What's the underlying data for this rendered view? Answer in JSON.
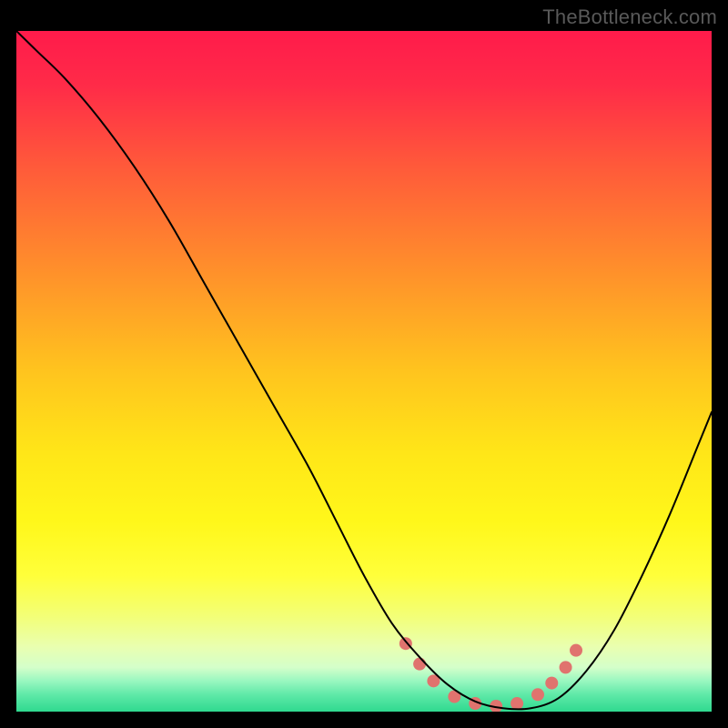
{
  "attribution": "TheBottleneck.com",
  "chart_data": {
    "type": "line",
    "title": "",
    "xlabel": "",
    "ylabel": "",
    "xlim": [
      0,
      100
    ],
    "ylim": [
      0,
      100
    ],
    "background_gradient": {
      "stops": [
        {
          "offset": 0.0,
          "color": "#ff1b4b"
        },
        {
          "offset": 0.08,
          "color": "#ff2b48"
        },
        {
          "offset": 0.2,
          "color": "#ff5a3a"
        },
        {
          "offset": 0.35,
          "color": "#ff8f2b"
        },
        {
          "offset": 0.5,
          "color": "#ffc41e"
        },
        {
          "offset": 0.62,
          "color": "#ffe618"
        },
        {
          "offset": 0.72,
          "color": "#fff71a"
        },
        {
          "offset": 0.8,
          "color": "#ffff3a"
        },
        {
          "offset": 0.86,
          "color": "#f3ff77"
        },
        {
          "offset": 0.905,
          "color": "#e9ffb0"
        },
        {
          "offset": 0.935,
          "color": "#d4ffca"
        },
        {
          "offset": 0.955,
          "color": "#99f7c0"
        },
        {
          "offset": 0.975,
          "color": "#5fe9a8"
        },
        {
          "offset": 1.0,
          "color": "#2fd98f"
        }
      ]
    },
    "series": [
      {
        "name": "bottleneck-curve",
        "color": "#000000",
        "width": 2.0,
        "x": [
          0,
          3,
          7,
          12,
          17,
          22,
          27,
          32,
          37,
          42,
          46,
          50,
          54,
          58,
          62,
          66,
          70,
          74,
          78,
          82,
          86,
          90,
          94,
          98,
          100
        ],
        "values": [
          100,
          97,
          93,
          87,
          80,
          72,
          63,
          54,
          45,
          36,
          28,
          20,
          13,
          8,
          4,
          1.5,
          0.5,
          0.5,
          2,
          6,
          12,
          20,
          29,
          39,
          44
        ]
      }
    ],
    "markers": {
      "name": "optimal-band",
      "color": "#e0736e",
      "radius": 7,
      "points": [
        {
          "x": 56,
          "y": 10
        },
        {
          "x": 58,
          "y": 7
        },
        {
          "x": 60,
          "y": 4.5
        },
        {
          "x": 63,
          "y": 2.2
        },
        {
          "x": 66,
          "y": 1.2
        },
        {
          "x": 69,
          "y": 0.8
        },
        {
          "x": 72,
          "y": 1.2
        },
        {
          "x": 75,
          "y": 2.5
        },
        {
          "x": 77,
          "y": 4.2
        },
        {
          "x": 79,
          "y": 6.5
        },
        {
          "x": 80.5,
          "y": 9
        }
      ]
    }
  }
}
